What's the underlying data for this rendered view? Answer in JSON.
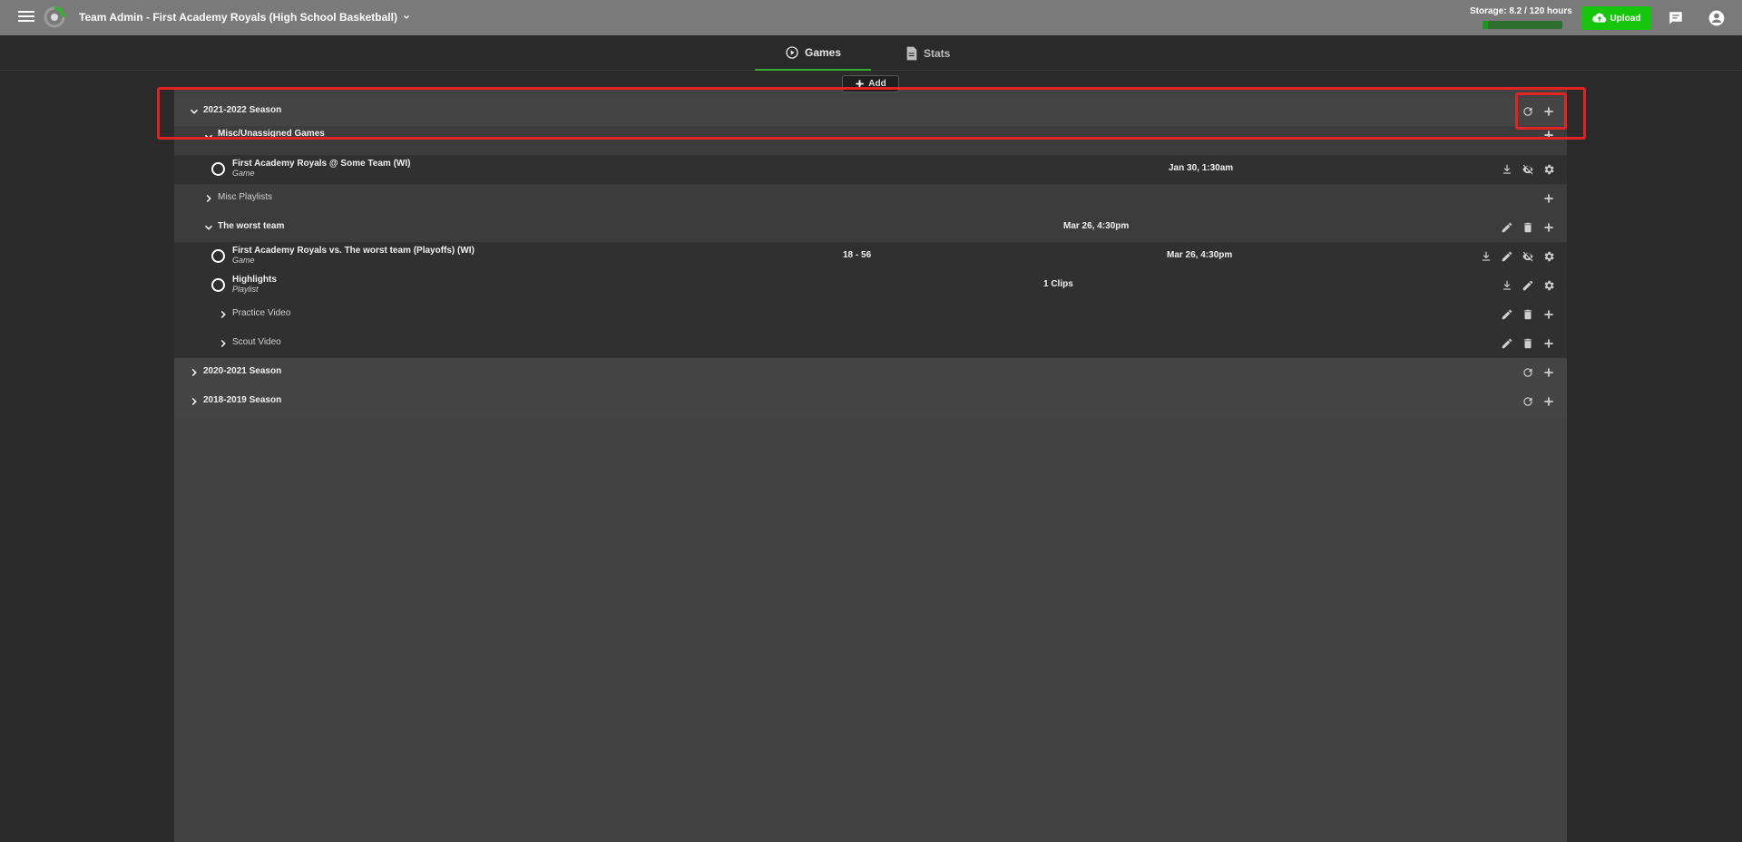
{
  "header": {
    "title": "Team Admin - First Academy Royals (High School Basketball)",
    "storage_label": "Storage: 8.2 / 120 hours",
    "storage_fraction": 0.068,
    "upload_label": "Upload"
  },
  "tabs": [
    {
      "label": "Games",
      "active": true
    },
    {
      "label": "Stats",
      "active": false
    }
  ],
  "add_label": "Add",
  "seasons": [
    {
      "label": "2021-2022 Season",
      "expanded": true
    },
    {
      "label": "2020-2021 Season",
      "expanded": false
    },
    {
      "label": "2018-2019 Season",
      "expanded": false
    }
  ],
  "groups": {
    "misc_games": {
      "label": "Misc/Unassigned Games"
    },
    "misc_playlists": {
      "label": "Misc Playlists"
    },
    "worst_team": {
      "label": "The worst team",
      "date": "Mar 26, 4:30pm"
    },
    "practice_video": {
      "label": "Practice Video"
    },
    "scout_video": {
      "label": "Scout Video"
    }
  },
  "items": {
    "game1": {
      "title": "First Academy Royals @ Some Team (WI)",
      "type": "Game",
      "date": "Jan 30, 1:30am"
    },
    "game2": {
      "title": "First Academy Royals vs. The worst team (Playoffs) (WI)",
      "type": "Game",
      "score": "18 - 56",
      "date": "Mar 26, 4:30pm"
    },
    "highlights": {
      "title": "Highlights",
      "type": "Playlist",
      "clips": "1 Clips"
    }
  },
  "colors": {
    "accent": "#16c60c",
    "highlight": "#e32222"
  }
}
